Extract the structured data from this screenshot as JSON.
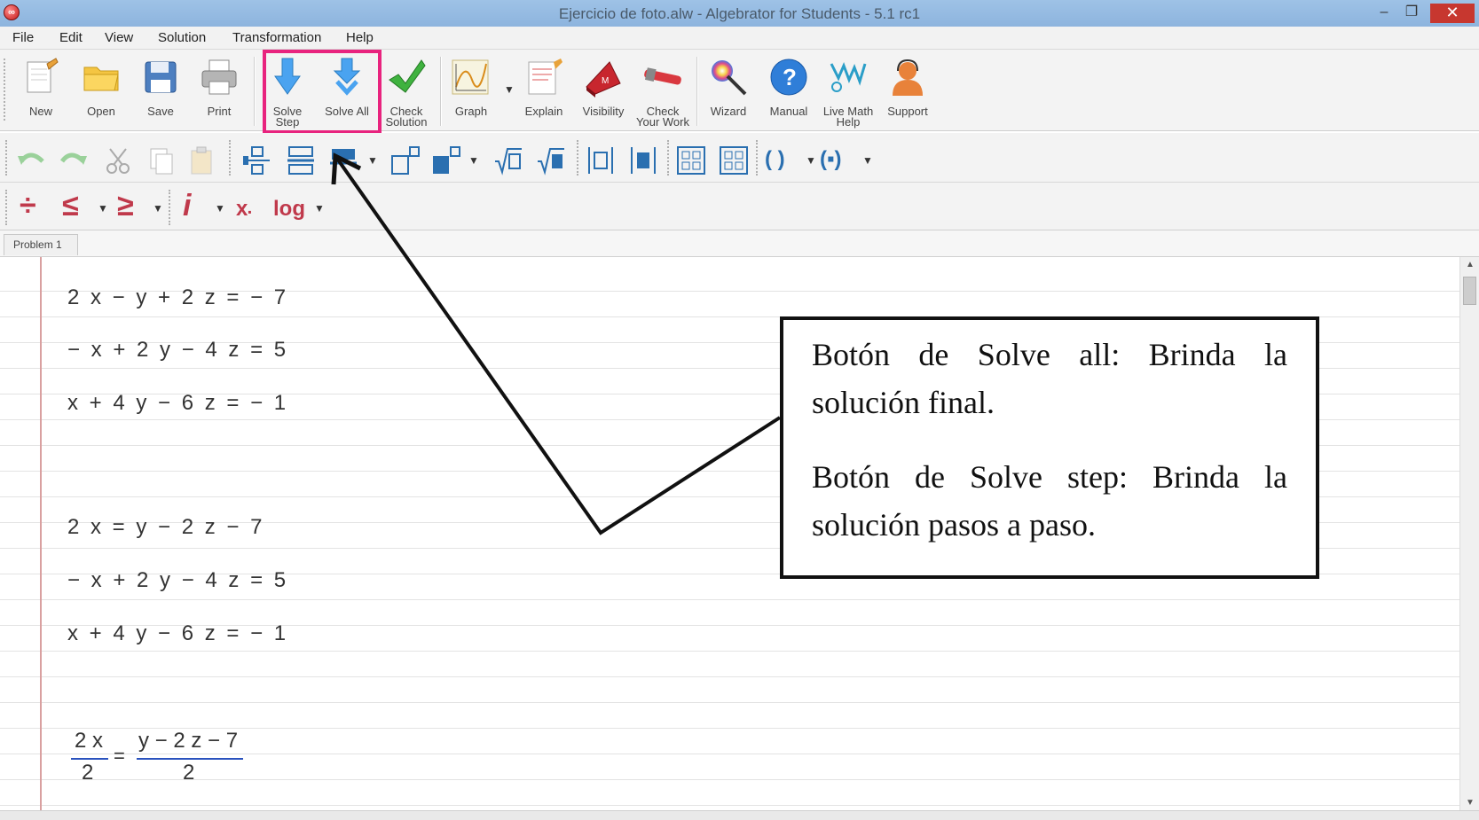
{
  "window": {
    "title": "Ejercicio de foto.alw - Algebrator for Students - 5.1 rc1",
    "min_glyph": "‒",
    "max_glyph": "❐",
    "close_glyph": "✕"
  },
  "menu": [
    "File",
    "Edit",
    "View",
    "Solution",
    "Transformation",
    "Help"
  ],
  "toolbar": {
    "new": "New",
    "open": "Open",
    "save": "Save",
    "print": "Print",
    "solve_step_1": "Solve",
    "solve_step_2": "Step",
    "solve_all": "Solve All",
    "check_solution_1": "Check",
    "check_solution_2": "Solution",
    "graph": "Graph",
    "explain": "Explain",
    "visibility": "Visibility",
    "check_work_1": "Check",
    "check_work_2": "Your Work",
    "wizard": "Wizard",
    "manual": "Manual",
    "live_math_1": "Live Math",
    "live_math_2": "Help",
    "support": "Support"
  },
  "math_toolbar": {
    "divide": "÷",
    "le": "≤",
    "ge": "≥",
    "imag": "i",
    "subscript": "x",
    "log": "log",
    "paren": "( )",
    "bracket": "(▪)"
  },
  "tabs": [
    "Problem 1"
  ],
  "equations": [
    "2 x − y + 2 z = − 7",
    "− x + 2 y − 4 z = 5",
    "x + 4 y − 6 z = − 1",
    "2 x = y − 2 z − 7",
    "− x + 2 y − 4 z = 5",
    "x + 4 y − 6 z = − 1"
  ],
  "fraction": {
    "left_num": "2 x",
    "left_den": "2",
    "equals": "=",
    "right_num": "y − 2 z − 7",
    "right_den": "2"
  },
  "annotation": {
    "line1": "Botón de Solve all: Brinda la solución final.",
    "line2": "Botón de Solve step: Brinda la solución pasos a paso."
  },
  "colors": {
    "highlight": "#e8237e",
    "symbol_red": "#c0394b",
    "solve_blue": "#4aa3f0"
  }
}
